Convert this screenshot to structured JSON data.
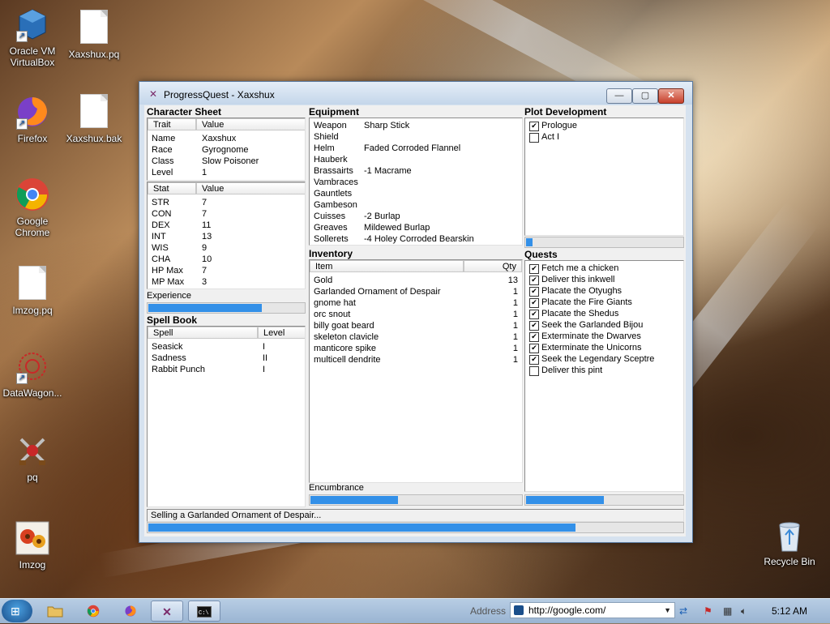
{
  "desktop": {
    "icons_left": [
      {
        "label": "Oracle VM VirtualBox",
        "icon": "virtualbox-icon"
      },
      {
        "label": "Firefox",
        "icon": "firefox-icon"
      },
      {
        "label": "Google Chrome",
        "icon": "chrome-icon"
      },
      {
        "label": "Imzog.pq",
        "icon": "file-icon"
      },
      {
        "label": "DataWagon...",
        "icon": "datawagon-icon"
      },
      {
        "label": "pq",
        "icon": "pq-icon"
      },
      {
        "label": "Imzog",
        "icon": "imzog-icon"
      }
    ],
    "icons_files": [
      {
        "label": "Xaxshux.pq"
      },
      {
        "label": "Xaxshux.bak"
      }
    ],
    "recycle_bin": "Recycle Bin"
  },
  "window": {
    "title": "ProgressQuest - Xaxshux",
    "buttons": {
      "minimize": "—",
      "maximize": "▢",
      "close": "✕"
    },
    "character_sheet": {
      "heading": "Character Sheet",
      "trait_header": "Trait",
      "value_header": "Value",
      "traits": [
        {
          "trait": "Name",
          "value": "Xaxshux"
        },
        {
          "trait": "Race",
          "value": "Gyrognome"
        },
        {
          "trait": "Class",
          "value": "Slow Poisoner"
        },
        {
          "trait": "Level",
          "value": "1"
        }
      ],
      "stat_header": "Stat",
      "stat_value_header": "Value",
      "stats": [
        {
          "stat": "STR",
          "value": "7"
        },
        {
          "stat": "CON",
          "value": "7"
        },
        {
          "stat": "DEX",
          "value": "11"
        },
        {
          "stat": "INT",
          "value": "13"
        },
        {
          "stat": "WIS",
          "value": "9"
        },
        {
          "stat": "CHA",
          "value": "10"
        },
        {
          "stat": "HP Max",
          "value": "7"
        },
        {
          "stat": "MP Max",
          "value": "3"
        }
      ],
      "experience_label": "Experience",
      "experience_progress": 0.73
    },
    "spell_book": {
      "heading": "Spell Book",
      "spell_header": "Spell",
      "level_header": "Level",
      "spells": [
        {
          "spell": "Seasick",
          "level": "I"
        },
        {
          "spell": "Sadness",
          "level": "II"
        },
        {
          "spell": "Rabbit Punch",
          "level": "I"
        }
      ]
    },
    "equipment": {
      "heading": "Equipment",
      "items": [
        {
          "slot": "Weapon",
          "item": "Sharp Stick"
        },
        {
          "slot": "Shield",
          "item": ""
        },
        {
          "slot": "Helm",
          "item": "Faded Corroded Flannel"
        },
        {
          "slot": "Hauberk",
          "item": ""
        },
        {
          "slot": "Brassairts",
          "item": "-1 Macrame"
        },
        {
          "slot": "Vambraces",
          "item": ""
        },
        {
          "slot": "Gauntlets",
          "item": ""
        },
        {
          "slot": "Gambeson",
          "item": ""
        },
        {
          "slot": "Cuisses",
          "item": "-2 Burlap"
        },
        {
          "slot": "Greaves",
          "item": "Mildewed Burlap"
        },
        {
          "slot": "Sollerets",
          "item": "-4 Holey Corroded Bearskin"
        }
      ]
    },
    "inventory": {
      "heading": "Inventory",
      "item_header": "Item",
      "qty_header": "Qty",
      "items": [
        {
          "item": "Gold",
          "qty": "13"
        },
        {
          "item": "Garlanded Ornament of Despair",
          "qty": "1"
        },
        {
          "item": "gnome hat",
          "qty": "1"
        },
        {
          "item": "orc snout",
          "qty": "1"
        },
        {
          "item": "billy goat beard",
          "qty": "1"
        },
        {
          "item": "skeleton clavicle",
          "qty": "1"
        },
        {
          "item": "manticore spike",
          "qty": "1"
        },
        {
          "item": "multicell dendrite",
          "qty": "1"
        }
      ],
      "encumbrance_label": "Encumbrance",
      "encumbrance_progress": 0.42
    },
    "plot": {
      "heading": "Plot Development",
      "acts": [
        {
          "label": "Prologue",
          "checked": true
        },
        {
          "label": "Act I",
          "checked": false
        }
      ],
      "progress": 0.05
    },
    "quests": {
      "heading": "Quests",
      "items": [
        {
          "label": "Fetch me a chicken",
          "checked": true
        },
        {
          "label": "Deliver this inkwell",
          "checked": true
        },
        {
          "label": "Placate the Otyughs",
          "checked": true
        },
        {
          "label": "Placate the Fire Giants",
          "checked": true
        },
        {
          "label": "Placate the Shedus",
          "checked": true
        },
        {
          "label": "Seek the Garlanded Bijou",
          "checked": true
        },
        {
          "label": "Exterminate the Dwarves",
          "checked": true
        },
        {
          "label": "Exterminate the Unicorns",
          "checked": true
        },
        {
          "label": "Seek the Legendary Sceptre",
          "checked": true
        },
        {
          "label": "Deliver this pint",
          "checked": false
        }
      ],
      "progress": 0.5
    },
    "status": {
      "text": "Selling a Garlanded Ornament of Despair...",
      "progress": 0.8
    }
  },
  "taskbar": {
    "address_label": "Address",
    "address_value": "http://google.com/",
    "clock": "5:12 AM",
    "colors": {
      "progress": "#3390e8"
    }
  }
}
